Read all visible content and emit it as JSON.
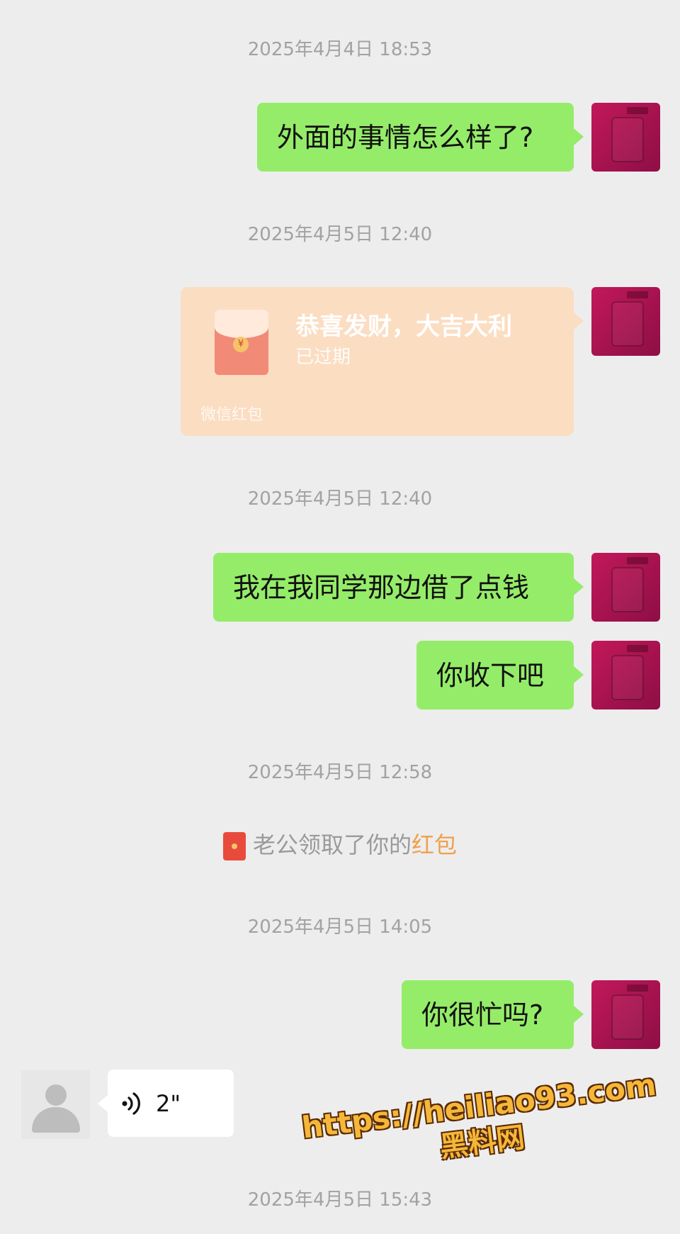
{
  "timestamps": [
    "2025年4月4日 18:53",
    "2025年4月5日 12:40",
    "2025年4月5日 12:40",
    "2025年4月5日 12:58",
    "2025年4月5日 14:05",
    "2025年4月5日 15:43"
  ],
  "messages": {
    "m1": "外面的事情怎么样了?",
    "m2": "我在我同学那边借了点钱",
    "m3": "你收下吧",
    "m4": "你很忙吗?"
  },
  "red_packet": {
    "coin_glyph": "¥",
    "title": "恭喜发财，大吉大利",
    "status": "已过期",
    "footer": "微信红包"
  },
  "system_message": {
    "text": "老公领取了你的",
    "link": "红包"
  },
  "voice_message": {
    "duration": "2\""
  },
  "watermark": {
    "url": "https://heiliao93.com",
    "site": "黑料网"
  },
  "colors": {
    "background": "#EDEDED",
    "my_bubble": "#95EC69",
    "other_bubble": "#FFFFFF",
    "red_packet_bg": "#FBDDC2",
    "red_packet_link": "#F0A04B",
    "timestamp": "#A2A2A2"
  }
}
